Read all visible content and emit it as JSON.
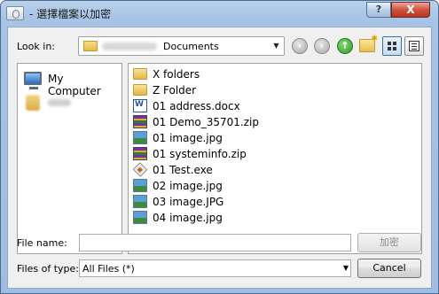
{
  "window": {
    "title": "- 選擇檔案以加密",
    "help_label": "?",
    "close_label": "X"
  },
  "toolbar": {
    "look_in_label": "Look in:",
    "look_in_value": "Documents",
    "back_icon": "back-arrow-icon",
    "forward_icon": "forward-arrow-icon",
    "up_icon": "up-folder-icon",
    "new_folder_icon": "new-folder-icon",
    "details_view_icon": "details-view-icon",
    "list_view_icon": "list-view-icon"
  },
  "places": [
    {
      "label": "My Computer",
      "icon": "my-computer-icon"
    },
    {
      "label": "",
      "icon": "user-folder-icon"
    }
  ],
  "files": [
    {
      "name": "X folders",
      "type": "folder"
    },
    {
      "name": "Z Folder",
      "type": "folder"
    },
    {
      "name": "01 address.docx",
      "type": "docx"
    },
    {
      "name": "01 Demo_35701.zip",
      "type": "zip"
    },
    {
      "name": "01 image.jpg",
      "type": "jpg"
    },
    {
      "name": "01 systeminfo.zip",
      "type": "zip"
    },
    {
      "name": "01 Test.exe",
      "type": "exe"
    },
    {
      "name": "02 image.jpg",
      "type": "jpg"
    },
    {
      "name": "03 image.JPG",
      "type": "jpg"
    },
    {
      "name": "04 image.jpg",
      "type": "jpg"
    }
  ],
  "footer": {
    "file_name_label": "File name:",
    "file_name_value": "",
    "files_of_type_label": "Files of type:",
    "files_of_type_value": "All Files (*)",
    "open_button": "加密",
    "cancel_button": "Cancel"
  }
}
